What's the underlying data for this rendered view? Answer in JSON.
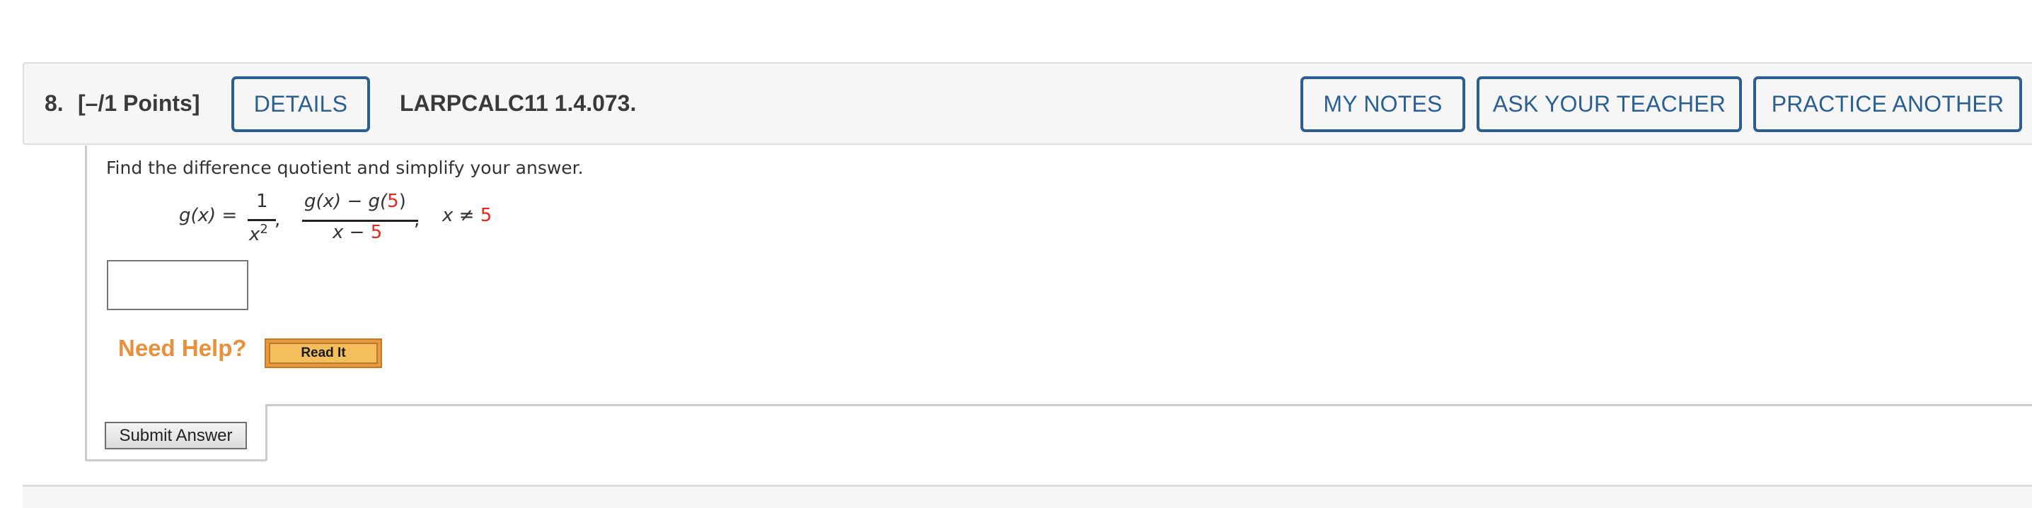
{
  "question": {
    "number": "8.",
    "points": "[–/1 Points]",
    "code": "LARPCALC11 1.4.073."
  },
  "header_buttons": {
    "details": "DETAILS",
    "my_notes": "MY NOTES",
    "ask_teacher": "ASK YOUR TEACHER",
    "practice_another": "PRACTICE ANOTHER"
  },
  "prompt": "Find the difference quotient and simplify your answer.",
  "math": {
    "function_lhs": "g(x) = ",
    "function_num": "1",
    "function_den_base": "x",
    "function_den_exp": "2",
    "comma": ",",
    "quotient_num_a": "g(x) − g(",
    "quotient_num_value": "5",
    "quotient_num_close": ")",
    "quotient_den_a": "x − ",
    "quotient_den_value": "5",
    "condition_a": "x ≠ ",
    "condition_value": "5"
  },
  "answer": {
    "value": "",
    "placeholder": ""
  },
  "help": {
    "label": "Need Help?",
    "read_it": "Read It"
  },
  "submit_label": "Submit Answer",
  "colors": {
    "accent_blue": "#2b5f92",
    "highlight_red": "#e8261a",
    "help_orange": "#e8903a"
  }
}
